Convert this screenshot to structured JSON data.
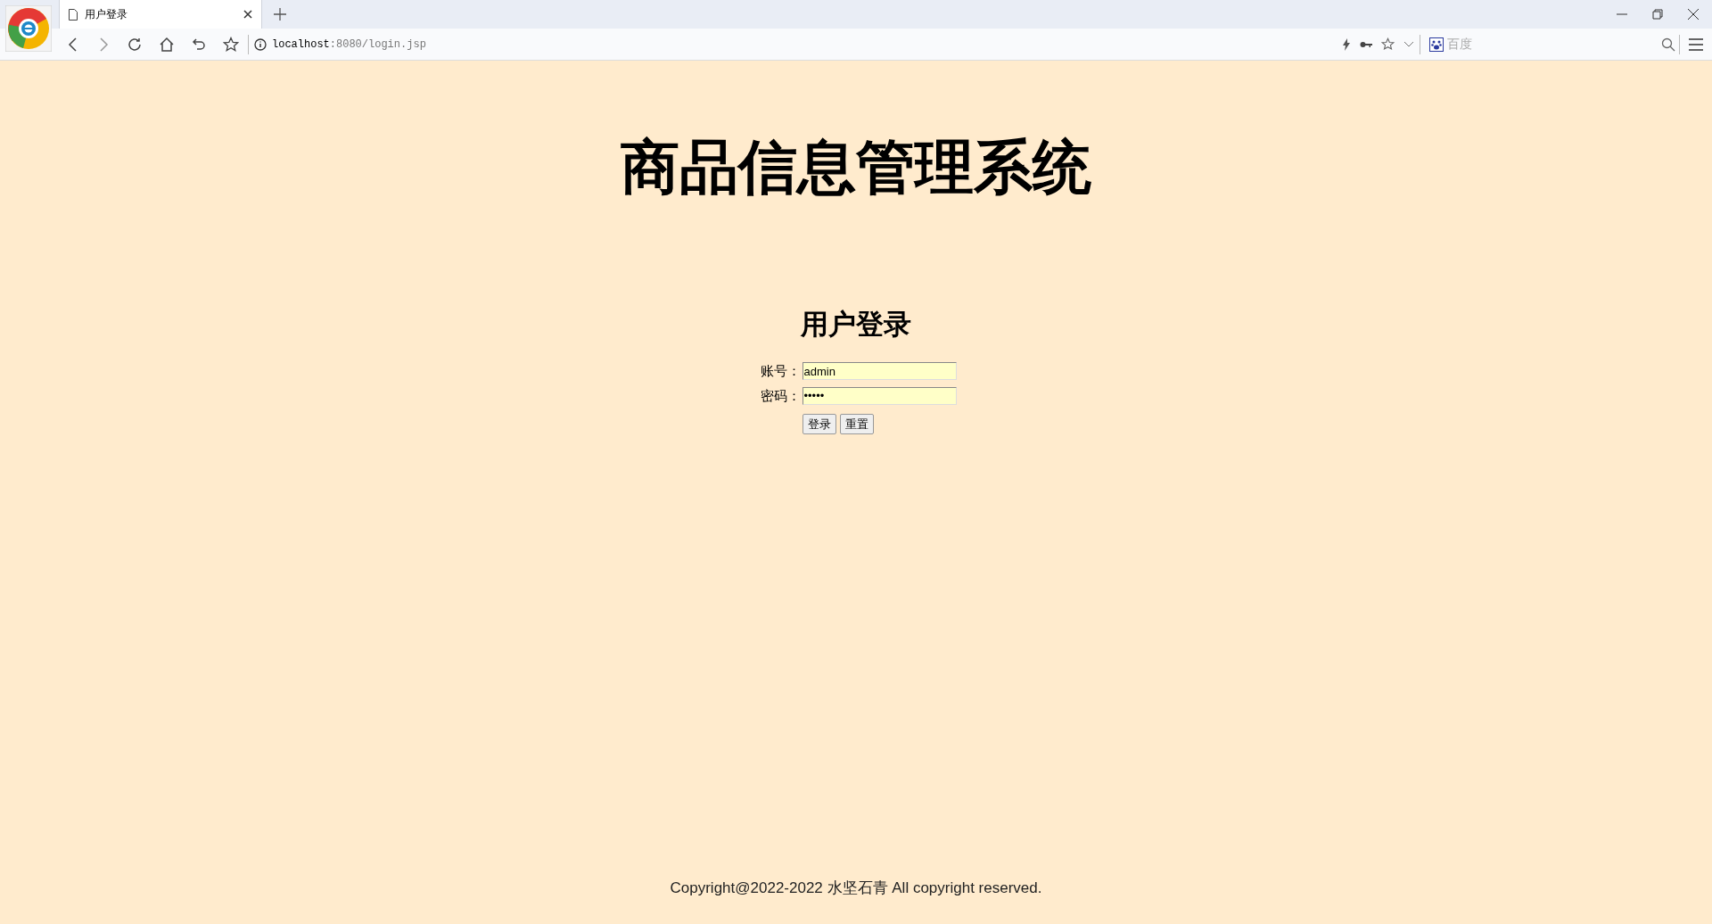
{
  "browser": {
    "tabs": [
      {
        "title": "用户登录",
        "selected": true
      }
    ],
    "address": {
      "host": "localhost",
      "rest": ":8080/login.jsp"
    },
    "search": {
      "placeholder": "百度"
    }
  },
  "page": {
    "title": "商品信息管理系统",
    "login_heading": "用户登录",
    "fields": [
      {
        "label": "账号：",
        "value": "admin"
      },
      {
        "label": "密码：",
        "value": "•••••"
      }
    ],
    "buttons": [
      "登录",
      "重置"
    ],
    "footer": "Copyright@2022-2022 水坚石青 All copyright reserved."
  }
}
